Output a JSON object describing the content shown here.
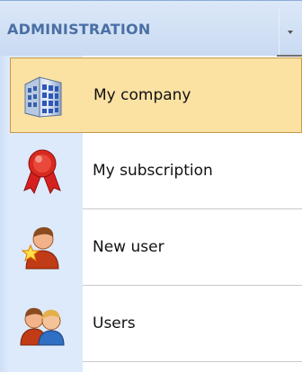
{
  "header": {
    "title": "ADMINISTRATION"
  },
  "menu": {
    "items": [
      {
        "label": "My company",
        "icon": "company-building-icon",
        "selected": true
      },
      {
        "label": "My subscription",
        "icon": "subscription-ribbon-icon",
        "selected": false
      },
      {
        "label": "New user",
        "icon": "new-user-icon",
        "selected": false
      },
      {
        "label": "Users",
        "icon": "users-icon",
        "selected": false
      }
    ]
  },
  "colors": {
    "header_bg": "#c9daf2",
    "header_text": "#4a6fa5",
    "gutter_bg": "#ddeafb",
    "selected_bg": "#fbe2a3",
    "selected_border": "#c79a4b"
  }
}
